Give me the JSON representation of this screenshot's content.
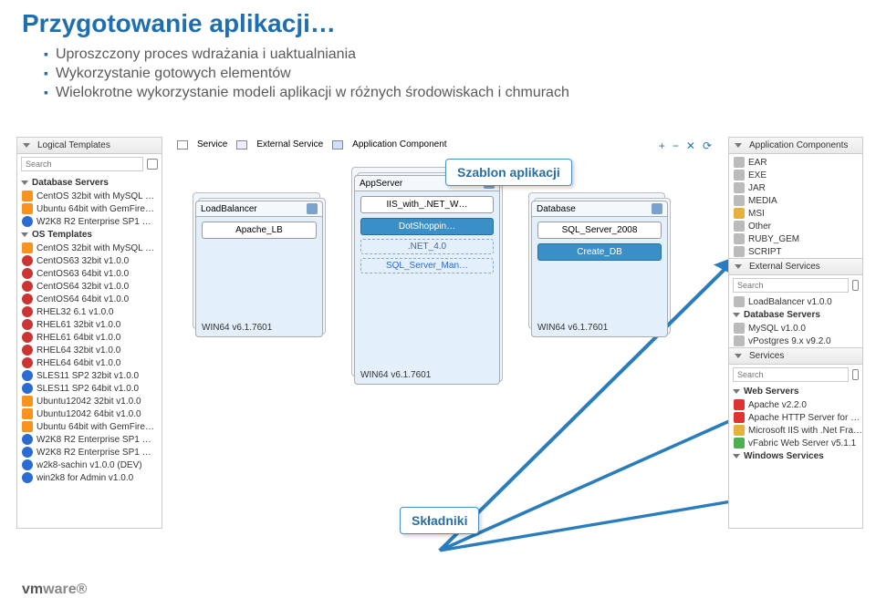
{
  "slide": {
    "title": "Przygotowanie aplikacji…",
    "bullets": [
      "Uproszczony proces wdrażania i uaktualniania",
      "Wykorzystanie gotowych elementów",
      "Wielokrotne wykorzystanie modeli aplikacji w różnych środowiskach i chmurach"
    ]
  },
  "callouts": {
    "template": "Szablon aplikacji",
    "components": "Składniki"
  },
  "legend": {
    "service": "Service",
    "external": "External Service",
    "component": "Application Component"
  },
  "left_panel": {
    "title": "Logical Templates",
    "search_placeholder": "Search",
    "sections": {
      "db_servers": {
        "label": "Database Servers",
        "items": [
          "CentOS 32bit with MySQL …",
          "Ubuntu 64bit with GemFire…",
          "W2K8 R2 Enterprise SP1 …"
        ]
      },
      "os_templates": {
        "label": "OS Templates",
        "items": [
          "CentOS 32bit with MySQL …",
          "CentOS63 32bit v1.0.0",
          "CentOS63 64bit v1.0.0",
          "CentOS64 32bit v1.0.0",
          "CentOS64 64bit v1.0.0",
          "RHEL32 6.1 v1.0.0",
          "RHEL61 32bit v1.0.0",
          "RHEL61 64bit v1.0.0",
          "RHEL64 32bit v1.0.0",
          "RHEL64 64bit v1.0.0",
          "SLES11 SP2 32bit v1.0.0",
          "SLES11 SP2 64bit v1.0.0",
          "Ubuntu12042 32bit v1.0.0",
          "Ubuntu12042 64bit v1.0.0",
          "Ubuntu 64bit with GemFire…",
          "W2K8 R2 Enterprise SP1 …",
          "W2K8 R2 Enterprise SP1 …",
          "w2k8-sachin v1.0.0 (DEV)",
          "win2k8 for Admin v1.0.0"
        ]
      }
    }
  },
  "right_panel": {
    "components": {
      "label": "Application Components",
      "items": [
        "EAR",
        "EXE",
        "JAR",
        "MEDIA",
        "MSI",
        "Other",
        "RUBY_GEM",
        "SCRIPT"
      ]
    },
    "external_services": {
      "label": "External Services",
      "search_placeholder": "Search",
      "items": [
        "LoadBalancer v1.0.0"
      ]
    },
    "db_servers": {
      "label": "Database Servers",
      "items": [
        "MySQL v1.0.0",
        "vPostgres 9.x v9.2.0"
      ]
    },
    "services": {
      "label": "Services",
      "search_placeholder": "Search",
      "web": {
        "label": "Web Servers",
        "items": [
          "Apache v2.2.0",
          "Apache HTTP Server for …",
          "Microsoft IIS with .Net Fra…",
          "vFabric Web Server v5.1.1"
        ]
      },
      "windows_label": "Windows Services"
    }
  },
  "toolbar": {
    "plus": "+",
    "minus": "−",
    "close": "✕",
    "reset": "⟳"
  },
  "canvas": {
    "lb": {
      "title": "LoadBalancer",
      "svc": "Apache_LB",
      "foot": "WIN64 v6.1.7601"
    },
    "app": {
      "title": "AppServer",
      "svc": "IIS_with_.NET_W…",
      "dot": "DotShoppin…",
      "net": ".NET_4.0",
      "sqlman": "SQL_Server_Man…",
      "foot": "WIN64 v6.1.7601"
    },
    "db": {
      "title": "Database",
      "svc": "SQL_Server_2008",
      "create": "Create_DB",
      "foot": "WIN64 v6.1.7601"
    }
  },
  "logo": {
    "brand": "vmware"
  }
}
